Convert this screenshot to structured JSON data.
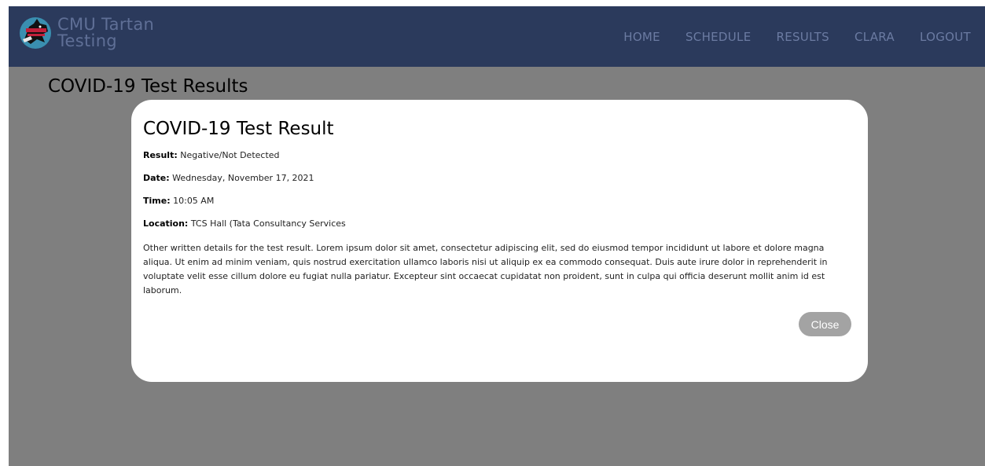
{
  "brand": {
    "line1": "CMU Tartan",
    "line2": "Testing"
  },
  "nav": {
    "items": [
      "HOME",
      "SCHEDULE",
      "RESULTS",
      "CLARA",
      "LOGOUT"
    ]
  },
  "page": {
    "title": "COVID-19 Test Results"
  },
  "modal": {
    "title": "COVID-19 Test Result",
    "fields": [
      {
        "label": "Result:",
        "value": "Negative/Not Detected"
      },
      {
        "label": "Date:",
        "value": "Wednesday, November 17, 2021"
      },
      {
        "label": "Time:",
        "value": "10:05 AM"
      },
      {
        "label": "Location:",
        "value": "TCS Hall (Tata Consultancy Services"
      }
    ],
    "details": "Other written details for the test result. Lorem ipsum dolor sit amet, consectetur adipiscing elit, sed do eiusmod tempor incididunt ut labore et dolore magna aliqua. Ut enim ad minim veniam, quis nostrud exercitation ullamco laboris nisi ut aliquip ex ea commodo consequat. Duis aute irure dolor in reprehenderit in voluptate velit esse cillum dolore eu fugiat nulla pariatur. Excepteur sint occaecat cupidatat non proident, sunt in culpa qui officia deserunt mollit anim id est laborum.",
    "close_label": "Close"
  },
  "colors": {
    "navbar": "#2b3a5c",
    "nav_text": "#6b7ba2",
    "overlay": "rgba(0,0,0,0.5)",
    "close_button": "#a3a3a3"
  },
  "icons": {
    "logo": "tartan-scottie-dog-logo"
  }
}
